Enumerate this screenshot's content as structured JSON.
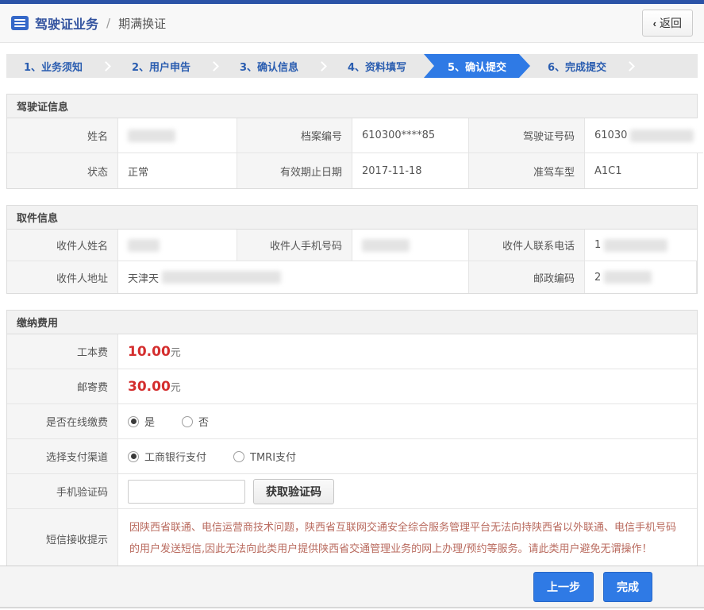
{
  "colors": {
    "accent_blue": "#2f7ae5",
    "navy_bar": "#2b53a7",
    "fee_red": "#d42e2e",
    "notice_red": "#b96a5e"
  },
  "header": {
    "title": "驾驶证业务",
    "divider": "/",
    "subtitle": "期满换证",
    "back_chevron": "‹",
    "back_label": "返回"
  },
  "steps": {
    "s1": "1、业务须知",
    "s2": "2、用户申告",
    "s3": "3、确认信息",
    "s4": "4、资料填写",
    "s5": "5、确认提交",
    "s6": "6、完成提交",
    "active": "5、确认提交"
  },
  "license": {
    "title": "驾驶证信息",
    "name_label": "姓名",
    "file_label": "档案编号",
    "file_value": "610300****85",
    "licno_label": "驾驶证号码",
    "licno_prefix": "61030",
    "status_label": "状态",
    "status_value": "正常",
    "expiry_label": "有效期止日期",
    "expiry_value": "2017-11-18",
    "class_label": "准驾车型",
    "class_value": "A1C1"
  },
  "pickup": {
    "title": "取件信息",
    "recipient_label": "收件人姓名",
    "mobile_label": "收件人手机号码",
    "phone_label": "收件人联系电话",
    "phone_prefix": "1",
    "address_label": "收件人地址",
    "address_prefix": "天津天",
    "zip_label": "邮政编码",
    "zip_prefix": "2"
  },
  "fees": {
    "title": "缴纳费用",
    "production_label": "工本费",
    "production_value": "10.00",
    "mail_label": "邮寄费",
    "mail_value": "30.00",
    "unit": "元",
    "online_label": "是否在线缴费",
    "online_yes": "是",
    "online_no": "否",
    "online_selected": "是",
    "channel_label": "选择支付渠道",
    "channel_icbc": "工商银行支付",
    "channel_tmri": "TMRI支付",
    "channel_selected": "工商银行支付",
    "code_label": "手机验证码",
    "code_value": "",
    "code_button": "获取验证码",
    "sms_label": "短信接收提示",
    "sms_notice": "因陕西省联通、电信运营商技术问题，陕西省互联网交通安全综合服务管理平台无法向持陕西省以外联通、电信手机号码的用户发送短信,因此无法向此类用户提供陕西省交通管理业务的网上办理/预约等服务。请此类用户避免无谓操作！"
  },
  "footer": {
    "prev": "上一步",
    "done": "完成"
  }
}
